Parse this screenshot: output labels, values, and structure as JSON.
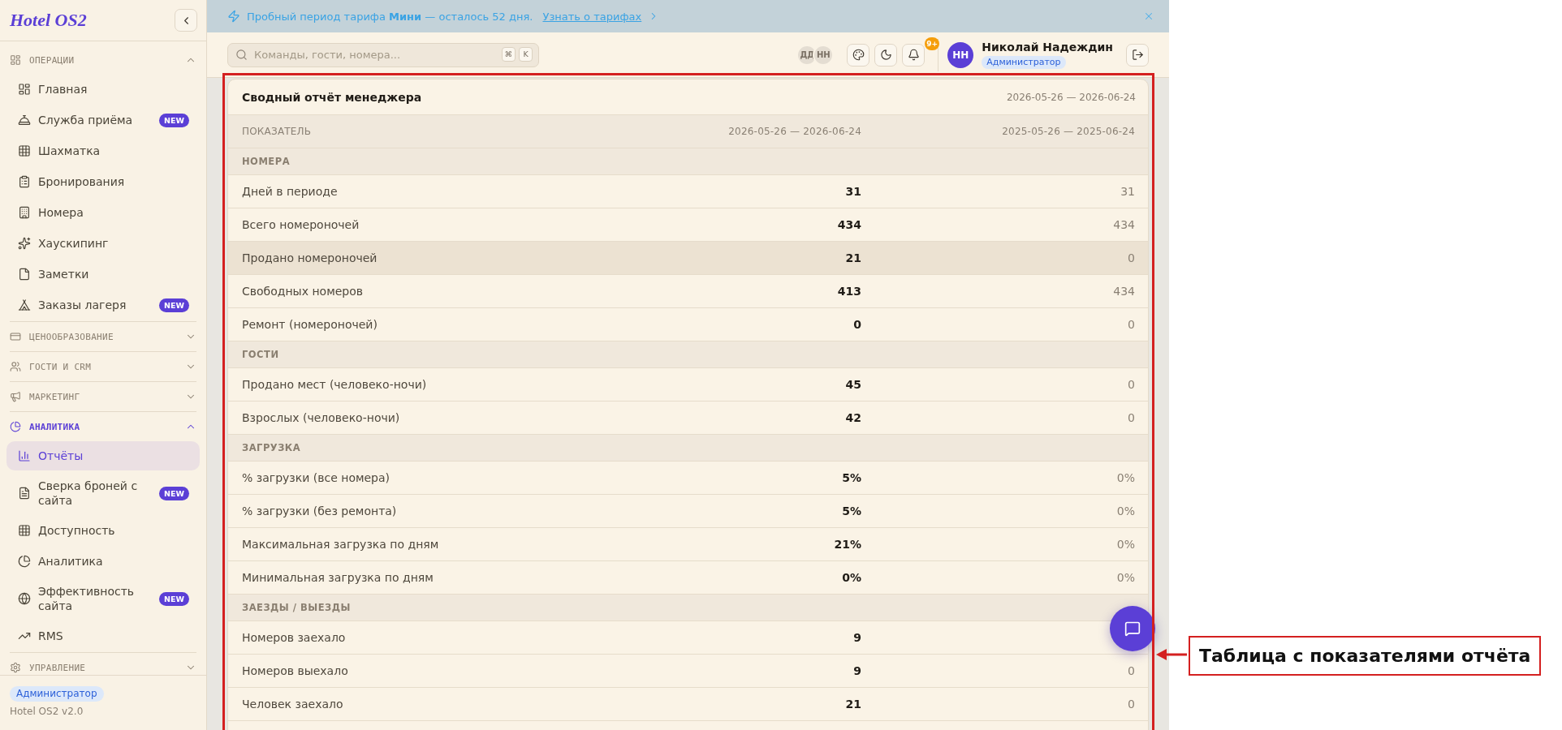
{
  "sidebar": {
    "logo": "Hotel OS2",
    "groups": [
      {
        "title": "ОПЕРАЦИИ",
        "expanded": true,
        "active": false,
        "items": [
          {
            "label": "Главная",
            "selected": false
          },
          {
            "label": "Служба приёма",
            "selected": false,
            "badge": "NEW"
          },
          {
            "label": "Шахматка",
            "selected": false
          },
          {
            "label": "Бронирования",
            "selected": false
          },
          {
            "label": "Номера",
            "selected": false
          },
          {
            "label": "Хаускипинг",
            "selected": false
          },
          {
            "label": "Заметки",
            "selected": false
          },
          {
            "label": "Заказы лагеря",
            "selected": false,
            "badge": "NEW"
          }
        ]
      },
      {
        "title": "ЦЕНООБРАЗОВАНИЕ",
        "expanded": false,
        "active": false
      },
      {
        "title": "ГОСТИ И CRM",
        "expanded": false,
        "active": false
      },
      {
        "title": "МАРКЕТИНГ",
        "expanded": false,
        "active": false
      },
      {
        "title": "АНАЛИТИКА",
        "expanded": true,
        "active": true,
        "items": [
          {
            "label": "Отчёты",
            "selected": true
          },
          {
            "label": "Сверка броней с сайта",
            "selected": false,
            "badge": "NEW"
          },
          {
            "label": "Доступность",
            "selected": false
          },
          {
            "label": "Аналитика",
            "selected": false
          },
          {
            "label": "Эффективность сайта",
            "selected": false,
            "badge": "NEW"
          },
          {
            "label": "RMS",
            "selected": false
          }
        ]
      },
      {
        "title": "УПРАВЛЕНИЕ",
        "expanded": false,
        "active": false
      }
    ],
    "footer": {
      "role": "Администратор",
      "version": "Hotel OS2 v2.0"
    }
  },
  "banner": {
    "text": "Пробный период тарифа **Мини** — осталось 52 дня.",
    "link": "Узнать о тарифах"
  },
  "header": {
    "search": {
      "placeholder": "Команды, гости, номера...",
      "shortcut": [
        "⌘",
        "K"
      ]
    },
    "online_users": [
      "ДД",
      "НН"
    ],
    "notifications": "9+",
    "user": {
      "initials": "НН",
      "name": "Николай Надеждин",
      "role": "Администратор"
    }
  },
  "report": {
    "title": "Сводный отчёт менеджера",
    "period": "2026-05-26 — 2026-06-24",
    "columns": [
      "ПОКАЗАТЕЛЬ",
      "2026-05-26 — 2026-06-24",
      "2025-05-26 — 2025-06-24"
    ],
    "sections": [
      {
        "title": "НОМЕРА",
        "rows": [
          {
            "label": "Дней в периоде",
            "current": "31",
            "previous": "31",
            "highlighted": false
          },
          {
            "label": "Всего номероночей",
            "current": "434",
            "previous": "434",
            "highlighted": false
          },
          {
            "label": "Продано номероночей",
            "current": "21",
            "previous": "0",
            "highlighted": true
          },
          {
            "label": "Свободных номеров",
            "current": "413",
            "previous": "434",
            "highlighted": false
          },
          {
            "label": "Ремонт (номероночей)",
            "current": "0",
            "previous": "0",
            "highlighted": false
          }
        ]
      },
      {
        "title": "ГОСТИ",
        "rows": [
          {
            "label": "Продано мест (человеко-ночи)",
            "current": "45",
            "previous": "0",
            "highlighted": false
          },
          {
            "label": "Взрослых (человеко-ночи)",
            "current": "42",
            "previous": "0",
            "highlighted": false
          }
        ]
      },
      {
        "title": "ЗАГРУЗКА",
        "rows": [
          {
            "label": "% загрузки (все номера)",
            "current": "5%",
            "previous": "0%",
            "highlighted": false
          },
          {
            "label": "% загрузки (без ремонта)",
            "current": "5%",
            "previous": "0%",
            "highlighted": false
          },
          {
            "label": "Максимальная загрузка по дням",
            "current": "21%",
            "previous": "0%",
            "highlighted": false
          },
          {
            "label": "Минимальная загрузка по дням",
            "current": "0%",
            "previous": "0%",
            "highlighted": false
          }
        ]
      },
      {
        "title": "ЗАЕЗДЫ / ВЫЕЗДЫ",
        "rows": [
          {
            "label": "Номеров заехало",
            "current": "9",
            "highlighted": false
          },
          {
            "label": "Номеров выехало",
            "current": "9",
            "previous": "0",
            "highlighted": false
          },
          {
            "label": "Человек заехало",
            "current": "21",
            "previous": "0",
            "highlighted": false
          }
        ]
      }
    ]
  },
  "annotation": {
    "label": "Таблица с показателями отчёта"
  }
}
